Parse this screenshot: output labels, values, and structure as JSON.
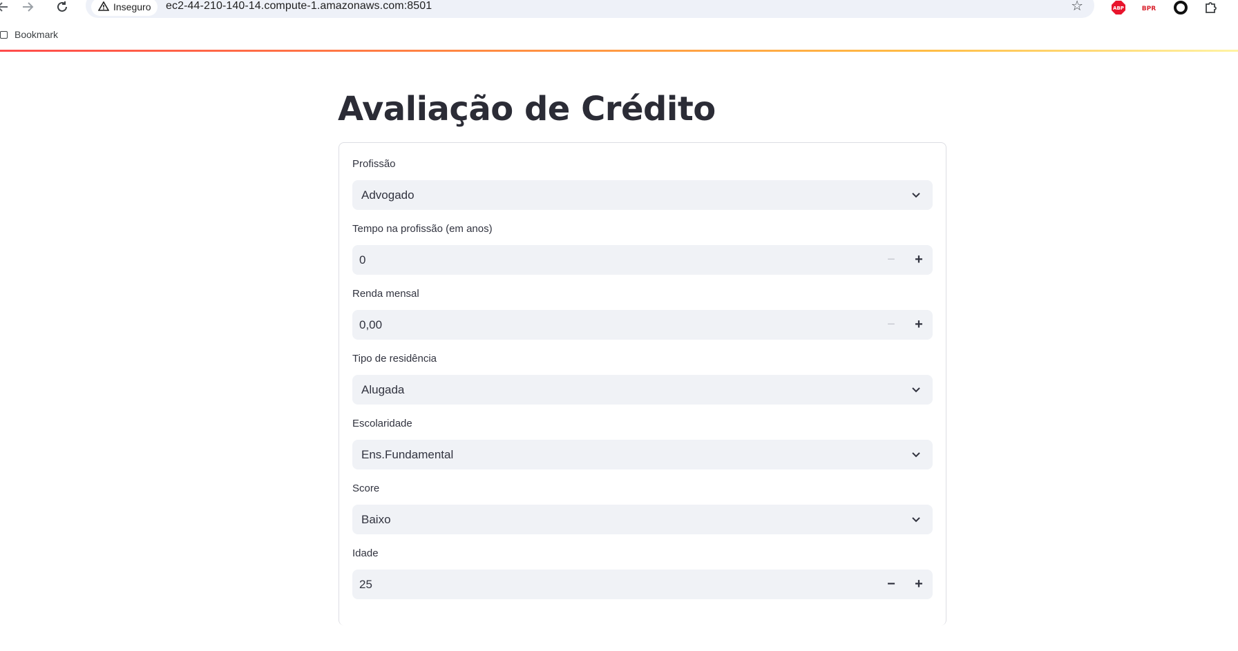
{
  "browser": {
    "security_label": "Inseguro",
    "url": "ec2-44-210-140-14.compute-1.amazonaws.com:8501",
    "bookmark_label": "Bookmark",
    "extensions": [
      "abp-icon",
      "bpr-icon",
      "circle-extension-icon",
      "puzzle-icon"
    ]
  },
  "page": {
    "title": "Avaliação de Crédito"
  },
  "form": {
    "profissao": {
      "label": "Profissão",
      "value": "Advogado"
    },
    "tempo": {
      "label": "Tempo na profissão (em anos)",
      "value": "0"
    },
    "renda": {
      "label": "Renda mensal",
      "value": "0,00"
    },
    "residencia": {
      "label": "Tipo de residência",
      "value": "Alugada"
    },
    "escolaridade": {
      "label": "Escolaridade",
      "value": "Ens.Fundamental"
    },
    "score": {
      "label": "Score",
      "value": "Baixo"
    },
    "idade": {
      "label": "Idade",
      "value": "25"
    }
  },
  "colors": {
    "accent_gradient_start": "#ff4b4b",
    "accent_gradient_end": "#fff3a3",
    "input_bg": "#f0f2f6"
  }
}
